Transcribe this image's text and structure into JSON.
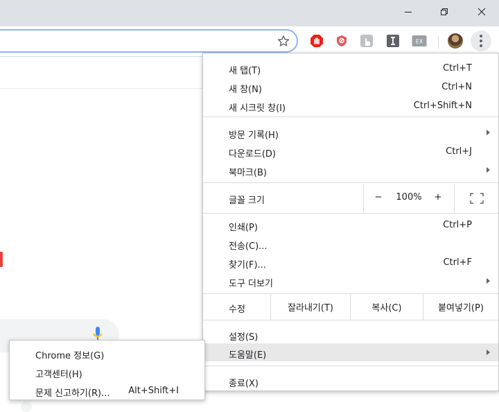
{
  "menu": {
    "new_tab": {
      "label": "새 탭(T)",
      "shortcut": "Ctrl+T"
    },
    "new_window": {
      "label": "새 창(N)",
      "shortcut": "Ctrl+N"
    },
    "new_incognito": {
      "label": "새 시크릿 창(I)",
      "shortcut": "Ctrl+Shift+N"
    },
    "history": {
      "label": "방문 기록(H)"
    },
    "downloads": {
      "label": "다운로드(D)",
      "shortcut": "Ctrl+J"
    },
    "bookmarks": {
      "label": "북마크(B)"
    },
    "zoom": {
      "label": "글꼴 크기",
      "minus": "−",
      "value": "100%",
      "plus": "+"
    },
    "print": {
      "label": "인쇄(P)",
      "shortcut": "Ctrl+P"
    },
    "cast": {
      "label": "전송(C)..."
    },
    "find": {
      "label": "찾기(F)...",
      "shortcut": "Ctrl+F"
    },
    "more_tools": {
      "label": "도구 더보기"
    },
    "edit": {
      "label": "수정",
      "cut": "잘라내기(T)",
      "copy": "복사(C)",
      "paste": "붙여넣기(P)"
    },
    "settings": {
      "label": "설정(S)"
    },
    "help": {
      "label": "도움말(E)"
    },
    "exit": {
      "label": "종료(X)"
    }
  },
  "help_submenu": {
    "about": {
      "label": "Chrome 정보(G)"
    },
    "help_center": {
      "label": "고객센터(H)"
    },
    "report": {
      "label": "문제 신고하기(R)...",
      "shortcut": "Alt+Shift+I"
    }
  },
  "extensions": [
    {
      "icon": "adblock-stop-icon",
      "color": "#e8231b"
    },
    {
      "icon": "shield-extension-icon",
      "color": "#e15a5a"
    },
    {
      "icon": "hand-cursor-extension-icon",
      "color": "#9aa0a6"
    },
    {
      "icon": "text-i-extension-icon",
      "color": "#5f6368",
      "text": "I"
    },
    {
      "icon": "ex-extension-icon",
      "color": "#9aa0a6",
      "text": "EX"
    }
  ],
  "colors": {
    "highlight": "#e8e8e9",
    "titlebar": "#dee1e6",
    "focus_ring": "#8ab4f8"
  }
}
